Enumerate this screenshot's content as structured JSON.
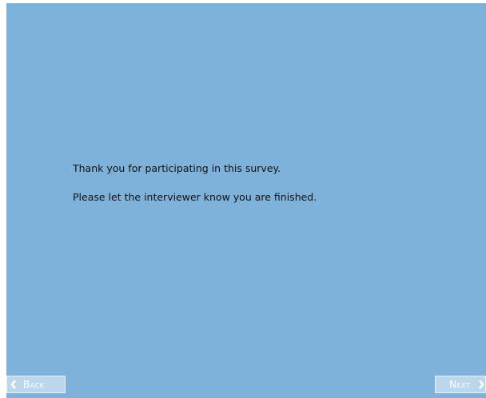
{
  "message": {
    "line1": "Thank you for participating in this survey.",
    "line2": "Please let the interviewer know you are finished."
  },
  "nav": {
    "back_label": "Back",
    "back_icon": "chevron-left-icon",
    "next_label": "Next",
    "next_icon": "chevron-right-icon"
  },
  "colors": {
    "background": "#7eb2db",
    "button": "#bcd7ec",
    "text": "#111111"
  }
}
